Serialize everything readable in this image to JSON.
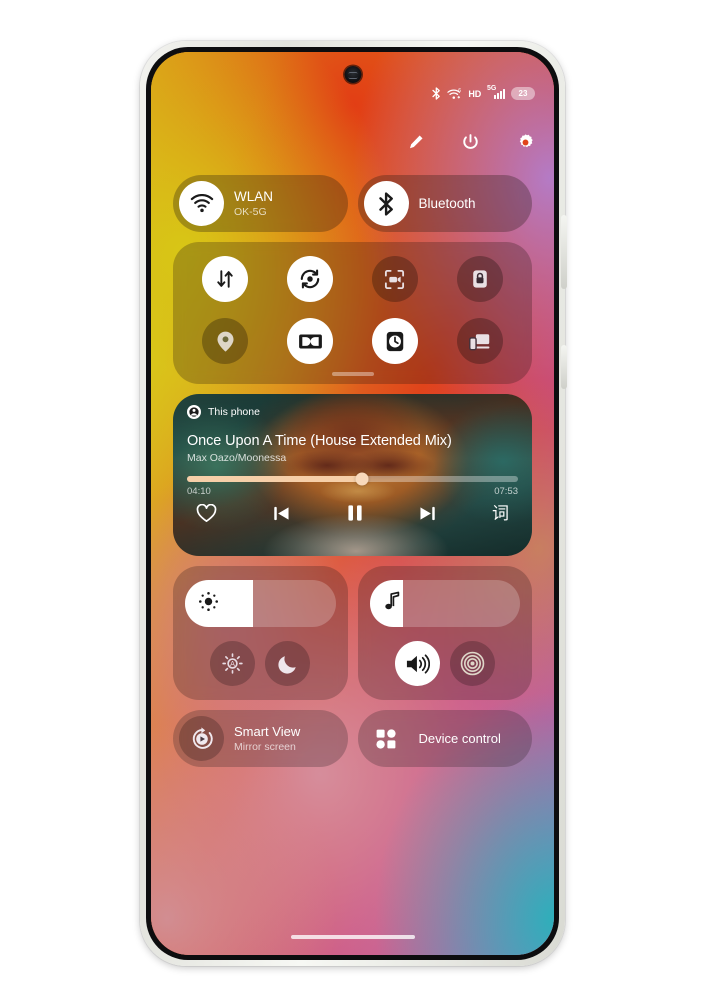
{
  "statusbar": {
    "bluetooth_icon": "bluetooth-icon",
    "wifi_icon": "wifi-icon",
    "hd_label": "HD",
    "network_label": "5G",
    "signal_icon": "cellular-signal-icon",
    "battery_level": "23"
  },
  "quick_actions": [
    {
      "name": "edit-button",
      "icon": "pencil-icon"
    },
    {
      "name": "power-button",
      "icon": "power-icon"
    },
    {
      "name": "settings-button",
      "icon": "gear-icon"
    }
  ],
  "connectivity": [
    {
      "title": "WLAN",
      "subtitle": "OK-5G",
      "icon": "wifi-icon",
      "active": true
    },
    {
      "title": "Bluetooth",
      "subtitle": "",
      "icon": "bluetooth-icon",
      "active": true
    }
  ],
  "toggles": [
    {
      "name": "mobile-data-toggle",
      "icon": "data-transfer-icon",
      "active": true
    },
    {
      "name": "auto-rotate-toggle",
      "icon": "auto-rotate-icon",
      "active": true
    },
    {
      "name": "screen-recorder-toggle",
      "icon": "screen-record-icon",
      "active": false
    },
    {
      "name": "screen-lock-toggle",
      "icon": "lock-icon",
      "active": false
    },
    {
      "name": "location-toggle",
      "icon": "location-pin-icon",
      "active": false
    },
    {
      "name": "dolby-atmos-toggle",
      "icon": "dolby-icon",
      "active": true
    },
    {
      "name": "focus-mode-toggle",
      "icon": "clock-icon",
      "active": true
    },
    {
      "name": "cast-toggle",
      "icon": "screen-cast-icon",
      "active": false
    }
  ],
  "media": {
    "source_label": "This phone",
    "source_icon": "speaker-source-icon",
    "title": "Once Upon A Time (House Extended Mix)",
    "artist": "Max Oazo/Moonessa",
    "elapsed": "04:10",
    "duration": "07:53",
    "progress_percent": 53,
    "controls": [
      {
        "name": "favorite-button",
        "icon": "heart-icon"
      },
      {
        "name": "previous-track-button",
        "icon": "skip-previous-icon"
      },
      {
        "name": "pause-button",
        "icon": "pause-icon"
      },
      {
        "name": "next-track-button",
        "icon": "skip-next-icon"
      },
      {
        "name": "lyrics-button",
        "icon": "lyrics-icon",
        "label": "词"
      }
    ]
  },
  "brightness": {
    "slider_name": "brightness-slider",
    "icon": "brightness-icon",
    "value_percent": 45,
    "buttons": [
      {
        "name": "auto-brightness-button",
        "icon": "auto-brightness-icon",
        "active": false
      },
      {
        "name": "dark-mode-button",
        "icon": "moon-icon",
        "active": false
      }
    ]
  },
  "volume": {
    "slider_name": "volume-slider",
    "icon": "music-note-icon",
    "value_percent": 22,
    "buttons": [
      {
        "name": "sound-mode-button",
        "icon": "speaker-icon",
        "active": true
      },
      {
        "name": "vibrate-mode-button",
        "icon": "vibration-icon",
        "active": false
      }
    ]
  },
  "bottom_tiles": [
    {
      "title": "Smart View",
      "subtitle": "Mirror screen",
      "icon": "smart-view-icon"
    },
    {
      "title": "Device control",
      "subtitle": "",
      "icon": "device-control-icon"
    }
  ],
  "colors": {
    "accent_fill": "#ffffff",
    "seek_fill": "#f6cfa8",
    "wallpaper_yellow": "#d9c71c",
    "wallpaper_orange": "#e0451c",
    "wallpaper_purple": "#a86fc4",
    "wallpaper_teal": "#2cb0ba",
    "wallpaper_pink": "#d691a0"
  }
}
